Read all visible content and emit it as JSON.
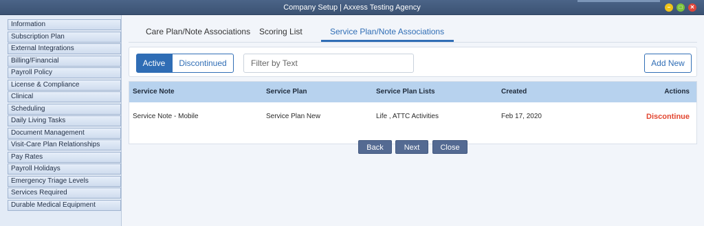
{
  "window": {
    "title": "Company Setup | Axxess Testing Agency"
  },
  "sidebar": {
    "items": [
      "Information",
      "Subscription Plan",
      "External Integrations",
      "Billing/Financial",
      "Payroll Policy",
      "License & Compliance",
      "Clinical",
      "Scheduling",
      "Daily Living Tasks",
      "Document Management",
      "Visit-Care Plan Relationships",
      "Pay Rates",
      "Payroll Holidays",
      "Emergency Triage Levels",
      "Services Required",
      "Durable Medical Equipment"
    ]
  },
  "tabs": [
    "Care Plan/Note Associations",
    "Scoring List",
    "Service Plan/Note Associations"
  ],
  "toolbar": {
    "active_label": "Active",
    "discontinued_label": "Discontinued",
    "filter_placeholder": "Filter by Text",
    "add_new_label": "Add New"
  },
  "table": {
    "headers": [
      "Service Note",
      "Service Plan",
      "Service Plan Lists",
      "Created",
      "Actions"
    ],
    "rows": [
      {
        "service_note": "Service Note - Mobile",
        "service_plan": "Service Plan New",
        "service_plan_lists": "Life , ATTC Activities",
        "created": "Feb 17, 2020",
        "action": "Discontinue"
      }
    ]
  },
  "footer": {
    "back_label": "Back",
    "next_label": "Next",
    "close_label": "Close"
  },
  "colors": {
    "accent": "#2f6db5",
    "header_bg": "#b7d2ee",
    "danger": "#e2452f",
    "titlebar": "#3b5272"
  }
}
